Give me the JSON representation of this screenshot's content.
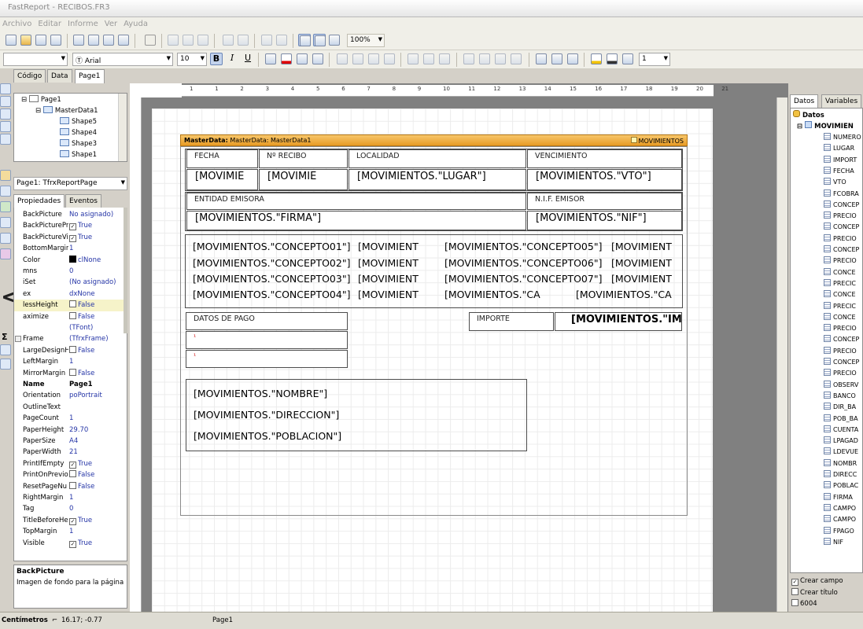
{
  "window": {
    "title": "FastReport - RECIBOS.FR3"
  },
  "menu": [
    "Archivo",
    "Editar",
    "Informe",
    "Ver",
    "Ayuda"
  ],
  "toolbar": {
    "zoom": "100%",
    "font_name": "Arial",
    "font_size": "10",
    "bold": "B",
    "italic": "I",
    "underline": "U",
    "frame_width": "1"
  },
  "tabs": [
    "Código",
    "Data",
    "Page1"
  ],
  "tree": {
    "items": [
      "Page1",
      "MasterData1",
      "Shape5",
      "Shape4",
      "Shape3",
      "Shape1"
    ]
  },
  "object_selector": "Page1: TfrxReportPage",
  "inspector": {
    "tabs": [
      "Propiedades",
      "Eventos"
    ],
    "rows": [
      {
        "n": "BackPicture",
        "v": "No asignado)"
      },
      {
        "n": "BackPicturePr",
        "v": "True",
        "c": true
      },
      {
        "n": "BackPictureVi",
        "v": "True",
        "c": true
      },
      {
        "n": "BottomMargin",
        "v": "1"
      },
      {
        "n": "Color",
        "v": "clNone",
        "sw": true
      },
      {
        "n": "mns",
        "v": "0"
      },
      {
        "n": "iSet",
        "v": "(No asignado)"
      },
      {
        "n": "ex",
        "v": "dxNone"
      },
      {
        "n": "lessHeight",
        "v": "False",
        "c": true,
        "hl": true
      },
      {
        "n": "aximize",
        "v": "False",
        "c": true
      },
      {
        "n": "",
        "v": "(TFont)"
      },
      {
        "n": "Frame",
        "v": "(TfrxFrame)",
        "plus": true
      },
      {
        "n": "LargeDesignH",
        "v": "False",
        "c": true
      },
      {
        "n": "LeftMargin",
        "v": "1"
      },
      {
        "n": "MirrorMargin",
        "v": "False",
        "c": true
      },
      {
        "n": "Name",
        "v": "Page1",
        "bold": true
      },
      {
        "n": "Orientation",
        "v": "poPortrait"
      },
      {
        "n": "OutlineText",
        "v": ""
      },
      {
        "n": "PageCount",
        "v": "1"
      },
      {
        "n": "PaperHeight",
        "v": "29.70"
      },
      {
        "n": "PaperSize",
        "v": "A4"
      },
      {
        "n": "PaperWidth",
        "v": "21"
      },
      {
        "n": "PrintIfEmpty",
        "v": "True",
        "c": true
      },
      {
        "n": "PrintOnPrevio",
        "v": "False",
        "c": true
      },
      {
        "n": "ResetPageNu",
        "v": "False",
        "c": true
      },
      {
        "n": "RightMargin",
        "v": "1"
      },
      {
        "n": "Tag",
        "v": "0"
      },
      {
        "n": "TitleBeforeHe",
        "v": "True",
        "c": true
      },
      {
        "n": "TopMargin",
        "v": "1"
      },
      {
        "n": "Visible",
        "v": "True",
        "c": true
      }
    ],
    "help_title": "BackPicture",
    "help_text": "Imagen de fondo para la página"
  },
  "ruler": [
    "1",
    "1",
    "2",
    "3",
    "4",
    "5",
    "6",
    "7",
    "8",
    "9",
    "10",
    "11",
    "12",
    "13",
    "14",
    "15",
    "16",
    "17",
    "18",
    "19",
    "20",
    "21"
  ],
  "band": {
    "left": "MasterData: MasterData1",
    "right": "MOVIMIENTOS"
  },
  "fields": {
    "fecha_lbl": "FECHA",
    "recibo_lbl": "Nº RECIBO",
    "localidad_lbl": "LOCALIDAD",
    "vencimiento_lbl": "VENCIMIENTO",
    "fecha_val": "[MOVIMIE",
    "recibo_val": "[MOVIMIE",
    "lugar_val": "[MOVIMIENTOS.\"LUGAR\"]",
    "vto_val": "[MOVIMIENTOS.\"VTO\"]",
    "entidad_lbl": "ENTIDAD EMISORA",
    "nif_lbl": "N.I.F. EMISOR",
    "firma_val": "[MOVIMIENTOS.\"FIRMA\"]",
    "nif_val": "[MOVIMIENTOS.\"NIF\"]",
    "c1": "[MOVIMIENTOS.\"CONCEPTO01\"]",
    "c2": "[MOVIMIENTOS.\"CONCEPTO02\"]",
    "c3": "[MOVIMIENTOS.\"CONCEPTO03\"]",
    "c4": "[MOVIMIENTOS.\"CONCEPTO04\"]",
    "c5": "[MOVIMIENTOS.\"CONCEPTO05\"]",
    "c6": "[MOVIMIENTOS.\"CONCEPTO06\"]",
    "c7": "[MOVIMIENTOS.\"CONCEPTO07\"]",
    "c8": "[MOVIMIENTOS.\"CA",
    "m1": "[MOVIMIENT",
    "m2": "[MOVIMIENT",
    "m3": "[MOVIMIENT",
    "m4": "[MOVIMIENT",
    "m5": "[MOVIMIENT",
    "m6": "[MOVIMIENT",
    "m7": "[MOVIMIENT",
    "m8": "[MOVIMIENTOS.\"CA",
    "pago_lbl": "DATOS DE PAGO",
    "importe_lbl": "IMPORTE",
    "importe_val": "[MOVIMIENTOS.\"IMP",
    "nombre": "[MOVIMIENTOS.\"NOMBRE\"]",
    "direccion": "[MOVIMIENTOS.\"DIRECCION\"]",
    "poblacion": "[MOVIMIENTOS.\"POBLACION\"]"
  },
  "right": {
    "tabs": [
      "Datos",
      "Variables"
    ],
    "root": "Datos",
    "dataset": "MOVIMIEN",
    "fields": [
      "NUMERO",
      "LUGAR",
      "IMPORT",
      "FECHA",
      "VTO",
      "FCOBRA",
      "CONCEP",
      "PRECIO",
      "CONCEP",
      "PRECIO",
      "CONCEP",
      "PRECIO",
      "CONCE",
      "PRECIC",
      "CONCE",
      "PRECIC",
      "CONCE",
      "PRECIO",
      "CONCEP",
      "PRECIO",
      "CONCEP",
      "PRECIO",
      "OBSERV",
      "BANCO",
      "DIR_BA",
      "POB_BA",
      "CUENTA",
      "LPAGAD",
      "LDEVUE",
      "NOMBR",
      "DIRECC",
      "POBLAC",
      "FIRMA",
      "CAMPO",
      "CAMPO",
      "FPAGO",
      "NIF"
    ],
    "opts": [
      "Crear campo",
      "Crear título",
      "6004"
    ]
  },
  "status": {
    "units": "Centímetros",
    "pos": "16.17; -0.77",
    "page": "Page1"
  }
}
